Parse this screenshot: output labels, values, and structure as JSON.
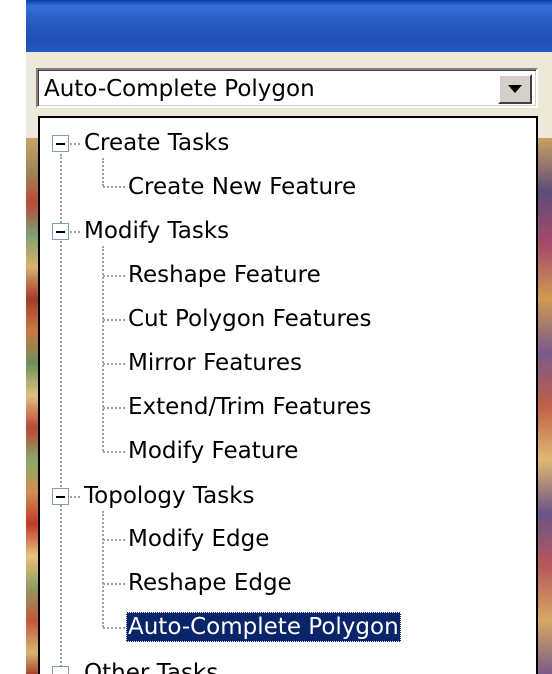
{
  "combo": {
    "value": "Auto-Complete Polygon",
    "button_icon": "chevron-down-icon"
  },
  "tree": {
    "groups": [
      {
        "label": "Create Tasks",
        "items": [
          "Create New Feature"
        ]
      },
      {
        "label": "Modify Tasks",
        "items": [
          "Reshape Feature",
          "Cut Polygon Features",
          "Mirror Features",
          "Extend/Trim Features",
          "Modify Feature"
        ]
      },
      {
        "label": "Topology Tasks",
        "items": [
          "Modify Edge",
          "Reshape Edge",
          "Auto-Complete Polygon"
        ]
      },
      {
        "label": "Other Tasks",
        "items": []
      }
    ],
    "selected_item": "Auto-Complete Polygon"
  },
  "colors": {
    "titlebar": "#2658bd",
    "selection": "#0a246a",
    "dialog_face": "#ece9d8"
  }
}
